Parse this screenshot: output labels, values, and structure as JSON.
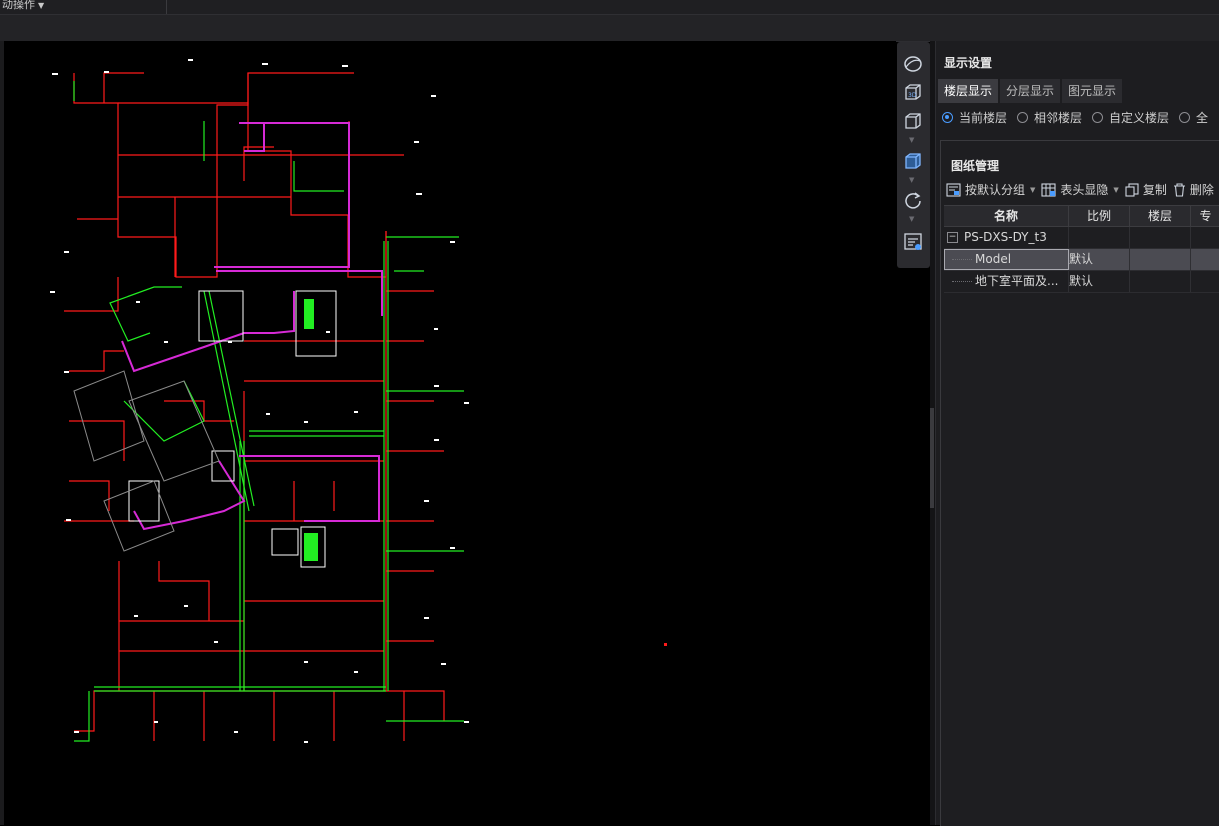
{
  "topbar": {
    "menu_label": "动操作"
  },
  "panel": {
    "title": "显示设置",
    "tabs": [
      {
        "label": "楼层显示",
        "active": true
      },
      {
        "label": "分层显示",
        "active": false
      },
      {
        "label": "图元显示",
        "active": false
      }
    ],
    "radios": [
      {
        "label": "当前楼层",
        "checked": true
      },
      {
        "label": "相邻楼层",
        "checked": false
      },
      {
        "label": "自定义楼层",
        "checked": false
      },
      {
        "label": "全",
        "checked": false
      }
    ]
  },
  "drawings": {
    "title": "图纸管理",
    "toolbar": {
      "group_label": "按默认分组",
      "header_label": "表头显隐",
      "copy_label": "复制",
      "delete_label": "删除"
    },
    "columns": [
      "名称",
      "比例",
      "楼层",
      "专"
    ],
    "tree": {
      "root": "PS-DXS-DY_t3",
      "children": [
        {
          "name": "Model",
          "scale": "默认",
          "selected": true
        },
        {
          "name": "地下室平面及...",
          "scale": "默认",
          "selected": false
        }
      ]
    }
  },
  "canvas": {
    "colors": {
      "red": "#ff1a1a",
      "green": "#22ee22",
      "magenta": "#d62ad6",
      "white": "#ffffff",
      "pink": "#ff6aa0"
    }
  }
}
